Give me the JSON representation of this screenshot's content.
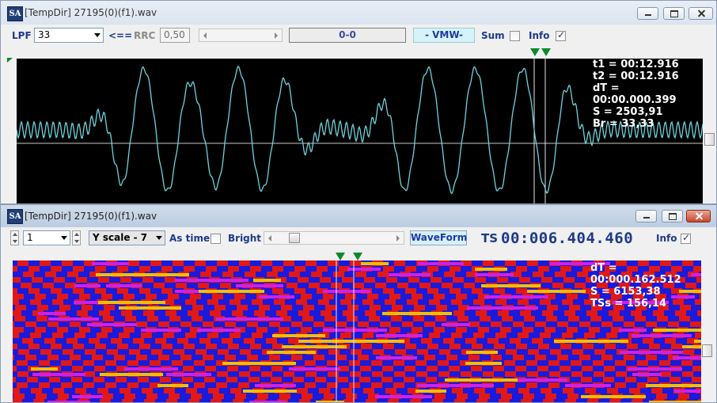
{
  "top_window": {
    "title": "[TempDir] 27195(0)(f1).wav",
    "toolbar": {
      "lpf_label": "LPF",
      "lpf_value": "33",
      "arrow_label": "<==",
      "rrc_label": "RRC",
      "rrc_value": "0,50",
      "readout": "0-0",
      "mode_button": "- VMW-",
      "sum_label": "Sum",
      "sum_checked": false,
      "info_label": "Info",
      "info_checked": true
    },
    "info": {
      "t1": "t1 = 00:12.916",
      "t2": "t2 = 00:12.916",
      "dt": "dT = 00:00.000.399",
      "s": "S = 2503,91",
      "br": "Br = 33,33"
    },
    "colors": {
      "background": "#000000",
      "trace": "#6fd3dc",
      "axis": "#c8c8c8",
      "marker": "#0a8a2a"
    }
  },
  "bottom_window": {
    "title": "[TempDir] 27195(0)(f1).wav",
    "toolbar": {
      "channel_value": "1",
      "yscale_value": "Y scale - 7",
      "as_time_label": "As time",
      "bright_label": "Bright",
      "bright_checked": false,
      "waveform_button": "WaveForm",
      "ts_label": "TS",
      "ts_value": "00:006.404.460",
      "info_label": "Info",
      "info_checked": true
    },
    "info": {
      "dt": "dT = 00:000.162.512",
      "s": "S = 6153,38",
      "tss": "TSs = 156,14"
    },
    "colors": {
      "red": "#e01818",
      "blue": "#1a1adc",
      "magenta": "#d020e8",
      "yellow": "#f0c000",
      "dark": "#200808"
    }
  }
}
